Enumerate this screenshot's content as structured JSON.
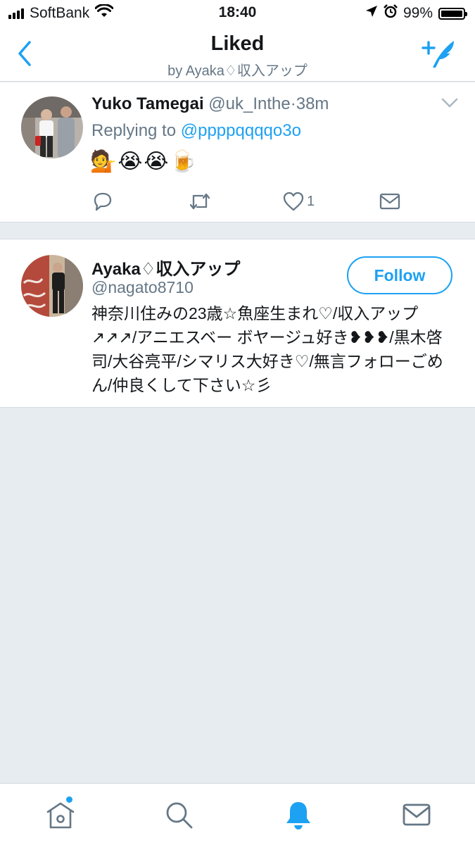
{
  "status_bar": {
    "carrier": "SoftBank",
    "time": "18:40",
    "battery": "99%"
  },
  "nav": {
    "title": "Liked",
    "subtitle": "by Ayaka♢収入アップ"
  },
  "tweet": {
    "name": "Yuko Tamegai",
    "handle": "@uk_Inthe",
    "separator": "·",
    "time": "38m",
    "replying_prefix": "Replying to ",
    "replying_to": "@ppppqqqqo3o",
    "text": "💁😭😭🍺",
    "like_count": "1"
  },
  "profile": {
    "name": "Ayaka♢収入アップ",
    "handle": "@nagato8710",
    "follow_label": "Follow",
    "bio": "神奈川住みの23歳☆魚座生まれ♡/収入アップ↗↗↗/アニエスベー ボヤージュ好き❥❥❥/黒木啓司/大谷亮平/シマリス大好き♡/無言フォローごめん/仲良くして下さい☆彡"
  },
  "colors": {
    "accent": "#1da1f2",
    "text_primary": "#14171a",
    "text_secondary": "#657786",
    "background": "#e6ecf0"
  },
  "icons": {
    "back": "chevron-left-icon",
    "compose": "compose-tweet-icon",
    "reply": "reply-icon",
    "retweet": "retweet-icon",
    "like": "heart-icon",
    "dm": "envelope-icon",
    "tab_home": "home-icon",
    "tab_search": "search-icon",
    "tab_notifications": "bell-icon",
    "tab_messages": "envelope-icon"
  }
}
